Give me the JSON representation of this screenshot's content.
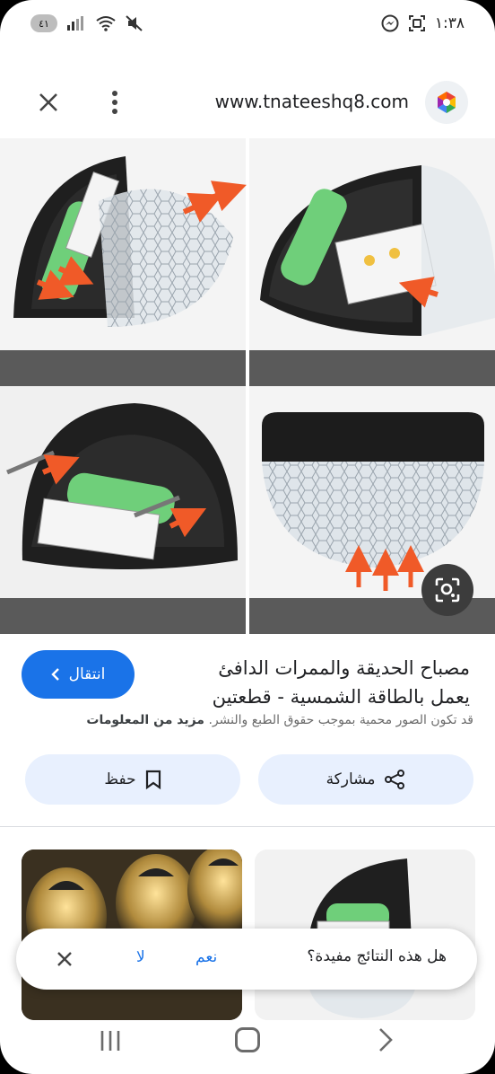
{
  "status_bar": {
    "time": "١:٣٨",
    "battery": "٤١"
  },
  "top_bar": {
    "url": "www.tnateeshq8.com"
  },
  "result": {
    "title": "مصباح الحديقة والممرات الدافئ يعمل بالطاقة الشمسية - قطعتين",
    "visit_label": "انتقال",
    "copyright_notice": "قد تكون الصور محمية بموجب حقوق الطبع والنشر.",
    "more_info": "مزيد من المعلومات",
    "save_label": "حفظ",
    "share_label": "مشاركة"
  },
  "feedback": {
    "question": "هل هذه النتائج مفيدة؟",
    "yes": "نعم",
    "no": "لا"
  },
  "colors": {
    "accent": "#1a73e8",
    "pill_bg": "#e8f0fe",
    "lamp_body": "#1f1f1f",
    "battery_green": "#6fcf7a",
    "arrow": "#f05a28"
  },
  "icons": [
    "battery-icon",
    "signal-icon",
    "wifi-icon",
    "mute-icon",
    "messenger-icon",
    "screenshot-icon",
    "close-icon",
    "more-vert-icon",
    "site-logo-icon",
    "lens-icon",
    "chevron-left-icon",
    "bookmark-icon",
    "share-icon",
    "recent-apps-icon",
    "home-icon",
    "back-icon"
  ]
}
